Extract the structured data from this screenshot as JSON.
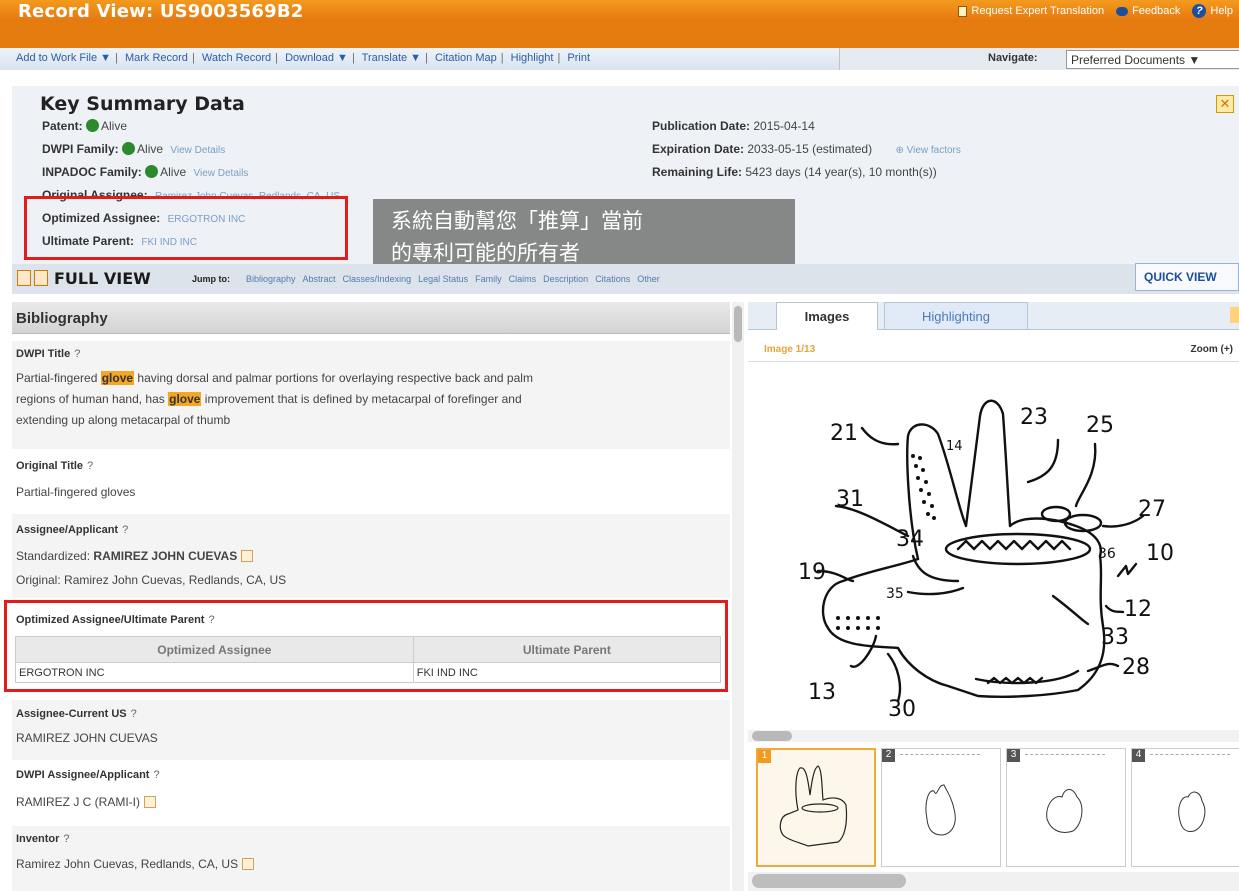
{
  "header": {
    "title": "Record View: US9003569B2",
    "links": {
      "request_translation": "Request Expert Translation",
      "feedback": "Feedback",
      "help": "Help"
    }
  },
  "menubar": {
    "items": [
      "Add to Work File ▼",
      "Mark Record",
      "Watch Record",
      "Download ▼",
      "Translate ▼",
      "Citation Map",
      "Highlight",
      "Print"
    ],
    "navigate_label": "Navigate:",
    "navigate_value": "Preferred Documents ▼"
  },
  "summary": {
    "title": "Key Summary Data",
    "patent_label": "Patent:",
    "patent_status": "Alive",
    "dwpi_family_label": "DWPI Family:",
    "dwpi_family_status": "Alive",
    "dwpi_family_link": "View Details",
    "inpadoc_family_label": "INPADOC Family:",
    "inpadoc_family_status": "Alive",
    "inpadoc_family_link": "View Details",
    "original_assignee_label": "Original Assignee:",
    "original_assignee_value": "Ramirez John Cuevas, Redlands, CA, US",
    "optimized_assignee_label": "Optimized Assignee:",
    "optimized_assignee_value": "ERGOTRON INC",
    "ultimate_parent_label": "Ultimate Parent:",
    "ultimate_parent_value": "FKI IND INC",
    "publication_date_label": "Publication Date:",
    "publication_date_value": "2015-04-14",
    "expiration_date_label": "Expiration Date:",
    "expiration_date_value": "2033-05-15 (estimated)",
    "view_factors": "View factors",
    "remaining_life_label": "Remaining Life:",
    "remaining_life_value": "5423 days (14 year(s), 10 month(s))",
    "close_symbol": "✕"
  },
  "tooltip": {
    "line1": "系統自動幫您「推算」當前",
    "line2": "的專利可能的所有者"
  },
  "fullview": {
    "title": "FULL VIEW",
    "jump_label": "Jump to:",
    "links": [
      "Bibliography",
      "Abstract",
      "Classes/Indexing",
      "Legal Status",
      "Family",
      "Claims",
      "Description",
      "Citations",
      "Other"
    ],
    "quick_view": "QUICK VIEW"
  },
  "bibliography": {
    "heading": "Bibliography",
    "dwpi_title_label": "DWPI Title",
    "dwpi_title_text": {
      "p1": "Partial-fingered ",
      "hl1": "glove",
      "p2": " having dorsal and palmar portions for overlaying respective back and palm",
      "p3": "regions of human hand, has ",
      "hl2": "glove",
      "p4": " improvement that is defined by metacarpal of forefinger and",
      "p5": "extending up along metacarpal of thumb"
    },
    "original_title_label": "Original Title",
    "original_title_value": "Partial-fingered gloves",
    "assignee_label": "Assignee/Applicant",
    "standardized_label": "Standardized:",
    "standardized_value": "RAMIREZ JOHN CUEVAS",
    "original_label": "Original:",
    "original_value": "Ramirez John Cuevas, Redlands, CA, US",
    "oa_label": "Optimized Assignee/Ultimate Parent",
    "oa_table": {
      "headers": [
        "Optimized Assignee",
        "Ultimate Parent"
      ],
      "row": [
        "ERGOTRON INC",
        "FKI IND INC"
      ]
    },
    "assignee_current_label": "Assignee-Current US",
    "assignee_current_value": "RAMIREZ JOHN CUEVAS",
    "dwpi_assignee_label": "DWPI Assignee/Applicant",
    "dwpi_assignee_value": "RAMIREZ J C (RAMI-I)",
    "inventor_label": "Inventor",
    "inventor_value": "Ramirez John Cuevas, Redlands, CA, US",
    "help_mark": "?"
  },
  "images_panel": {
    "tabs": [
      "Images",
      "Highlighting"
    ],
    "image_count": "Image 1/13",
    "zoom": "Zoom (+)",
    "figure_labels": [
      "21",
      "14",
      "23",
      "25",
      "31",
      "27",
      "34",
      "36",
      "10",
      "19",
      "35",
      "12",
      "33",
      "13",
      "30",
      "28"
    ],
    "thumbnail_numbers": [
      "1",
      "2",
      "3",
      "4"
    ]
  }
}
